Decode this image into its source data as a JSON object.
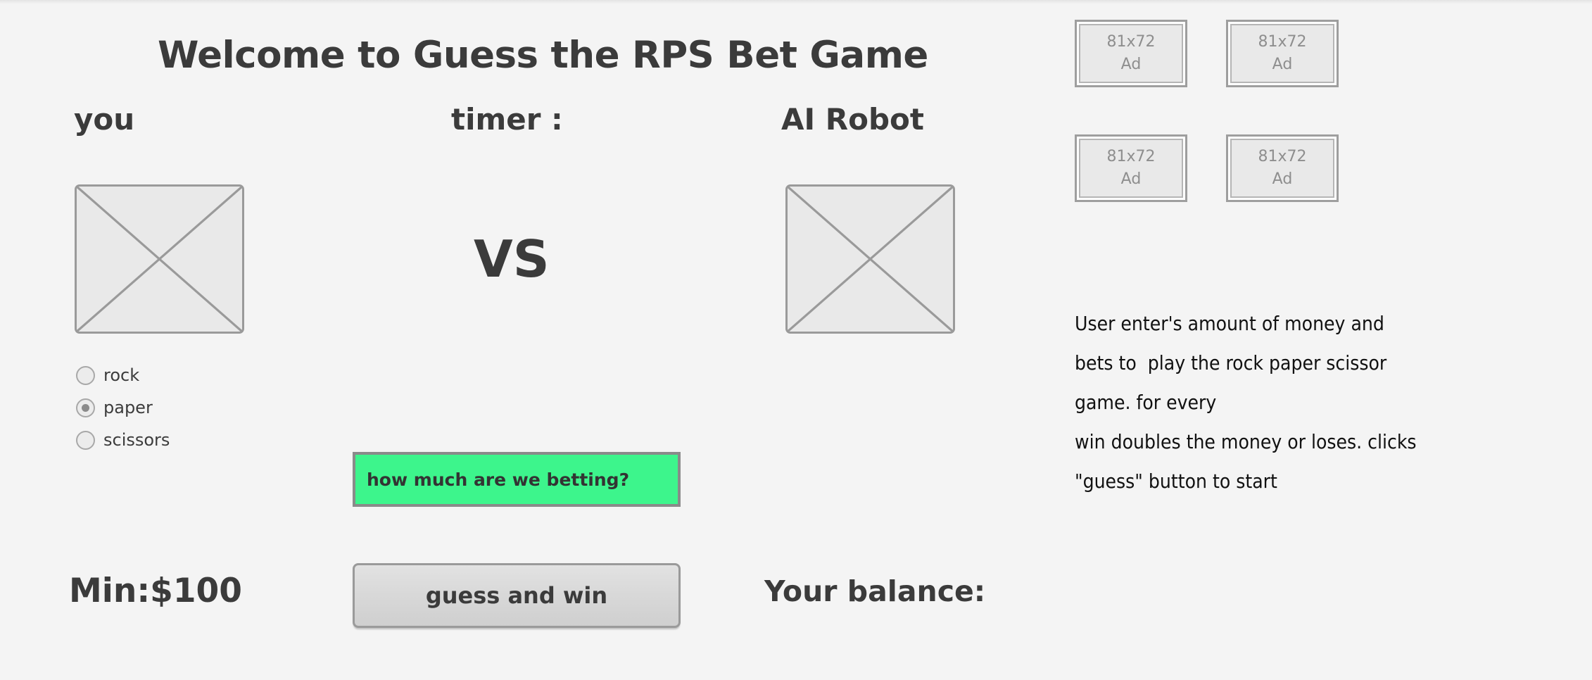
{
  "page": {
    "title": "Welcome to Guess the RPS Bet Game",
    "background_color": "#f4f4f4"
  },
  "players": {
    "you_label": "you",
    "timer_label": "timer :",
    "ai_label": "AI Robot",
    "vs_label": "VS"
  },
  "choices": {
    "options": [
      {
        "label": "rock",
        "selected": false
      },
      {
        "label": "paper",
        "selected": true
      },
      {
        "label": "scissors",
        "selected": false
      }
    ],
    "selected_value": "paper"
  },
  "bet": {
    "input_value": "how much are we betting?",
    "input_color": "#3df58c",
    "min_label": "Min:$100",
    "balance_label": "Your balance:",
    "submit_label": "guess and win"
  },
  "ads": {
    "items": [
      {
        "size": "81x72",
        "label": "Ad"
      },
      {
        "size": "81x72",
        "label": "Ad"
      },
      {
        "size": "81x72",
        "label": "Ad"
      },
      {
        "size": "81x72",
        "label": "Ad"
      }
    ]
  },
  "notes": {
    "text": "User enter's amount of money and\nbets to  play the rock paper scissor\ngame. for every\nwin doubles the money or loses. clicks\n\"guess\" button to start"
  }
}
